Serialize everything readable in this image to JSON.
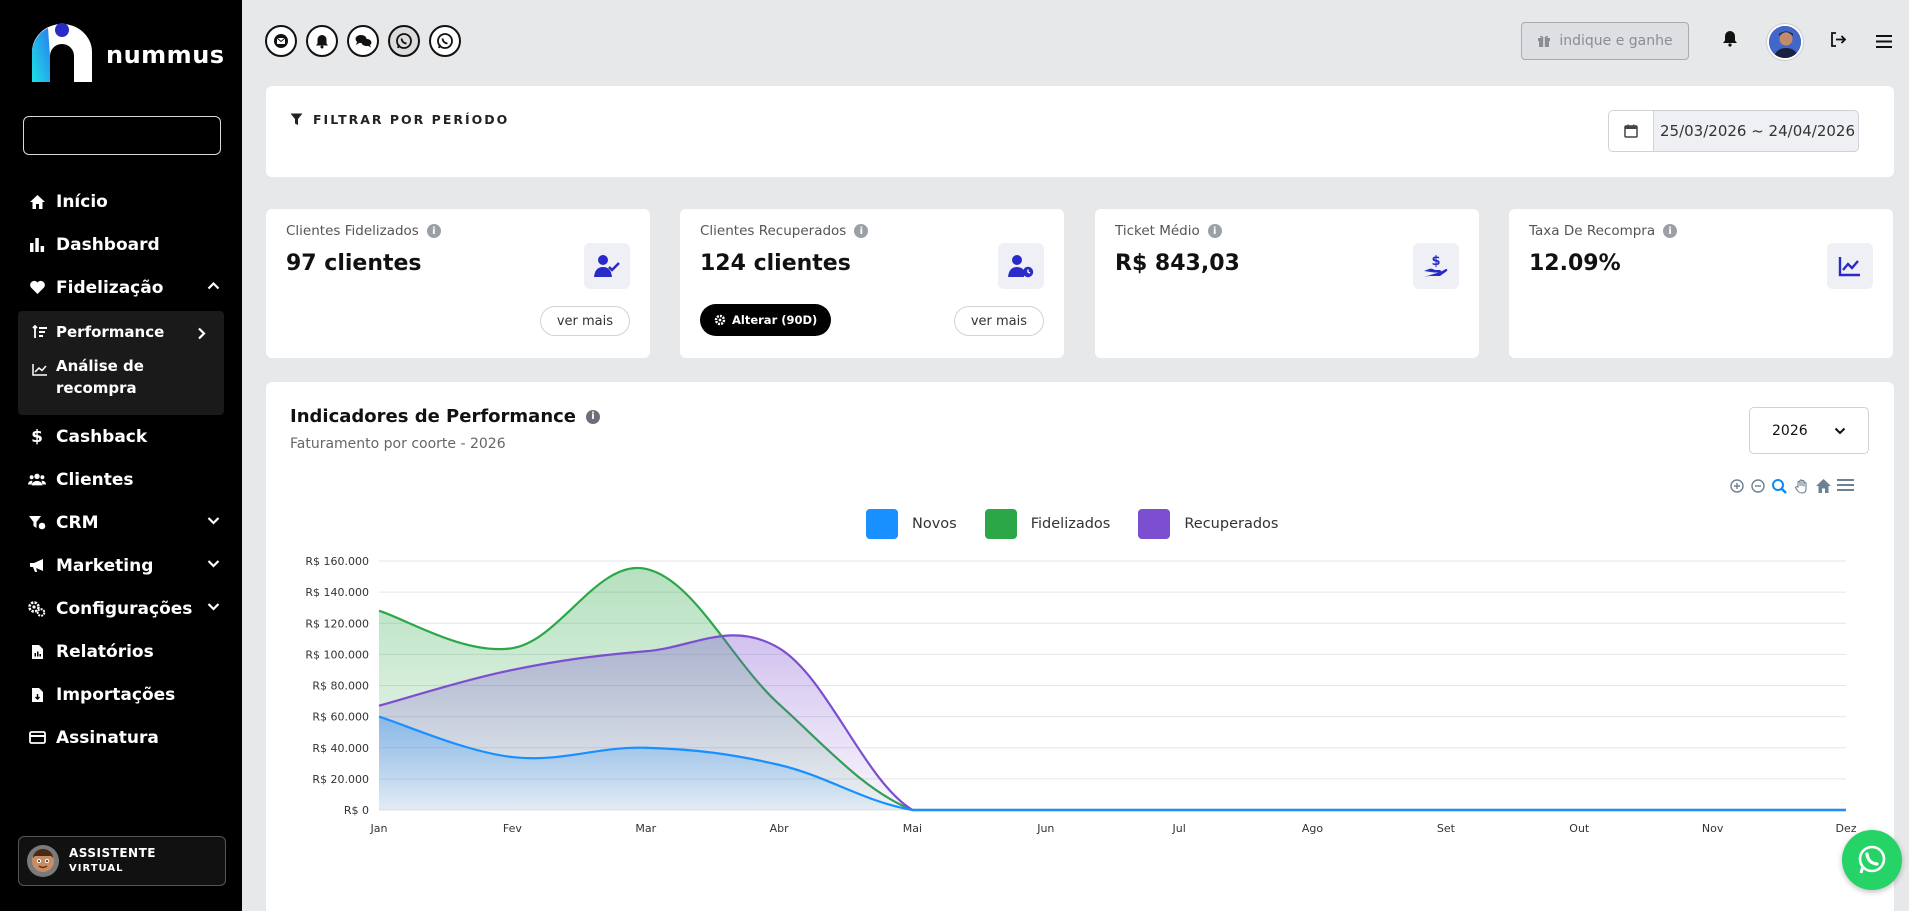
{
  "brand": {
    "name": "nummus"
  },
  "sidebar": {
    "search_placeholder": "",
    "items": [
      {
        "label": "Início"
      },
      {
        "label": "Dashboard"
      },
      {
        "label": "Fidelização"
      },
      {
        "label": "Cashback"
      },
      {
        "label": "Clientes"
      },
      {
        "label": "CRM"
      },
      {
        "label": "Marketing"
      },
      {
        "label": "Configurações"
      },
      {
        "label": "Relatórios"
      },
      {
        "label": "Importações"
      },
      {
        "label": "Assinatura"
      }
    ],
    "sub_items": [
      {
        "label": "Performance"
      },
      {
        "label": "Análise de",
        "label2": "recompra"
      }
    ],
    "assistant": {
      "line1": "ASSISTENTE",
      "line2": "VIRTUAL"
    }
  },
  "topbar": {
    "indique": "indique e ganhe"
  },
  "filter": {
    "label": "FILTRAR POR PERÍODO",
    "range": "25/03/2026 ~ 24/04/2026"
  },
  "stats": [
    {
      "label": "Clientes Fidelizados",
      "value": "97 clientes",
      "more": "ver mais"
    },
    {
      "label": "Clientes Recuperados",
      "value": "124 clientes",
      "more": "ver mais",
      "alterar": "Alterar (90D)"
    },
    {
      "label": "Ticket Médio",
      "value": "R$ 843,03"
    },
    {
      "label": "Taxa De Recompra",
      "value": "12.09%"
    }
  ],
  "performance": {
    "title": "Indicadores de Performance",
    "subtitle": "Faturamento por coorte - 2026",
    "year": "2026"
  },
  "colors": {
    "novos": "#1890ff",
    "fidelizados": "#2ca747",
    "recuperados": "#7b4fcf",
    "accent": "#2a2ac8"
  },
  "chart_data": {
    "type": "area",
    "categories": [
      "Jan",
      "Fev",
      "Mar",
      "Abr",
      "Mai",
      "Jun",
      "Jul",
      "Ago",
      "Set",
      "Out",
      "Nov",
      "Dez"
    ],
    "series": [
      {
        "name": "Novos",
        "values": [
          60000,
          34000,
          40000,
          29000,
          0,
          0,
          0,
          0,
          0,
          0,
          0,
          0
        ]
      },
      {
        "name": "Fidelizados",
        "values": [
          128000,
          104000,
          155000,
          68000,
          0,
          0,
          0,
          0,
          0,
          0,
          0,
          0
        ]
      },
      {
        "name": "Recuperados",
        "values": [
          67000,
          90000,
          102000,
          104000,
          0,
          0,
          0,
          0,
          0,
          0,
          0,
          0
        ]
      }
    ],
    "yticks": [
      "R$ 0",
      "R$ 20.000",
      "R$ 40.000",
      "R$ 60.000",
      "R$ 80.000",
      "R$ 100.000",
      "R$ 120.000",
      "R$ 140.000",
      "R$ 160.000"
    ],
    "ylim": [
      0,
      160000
    ],
    "grid": true,
    "legend": "top-center"
  }
}
